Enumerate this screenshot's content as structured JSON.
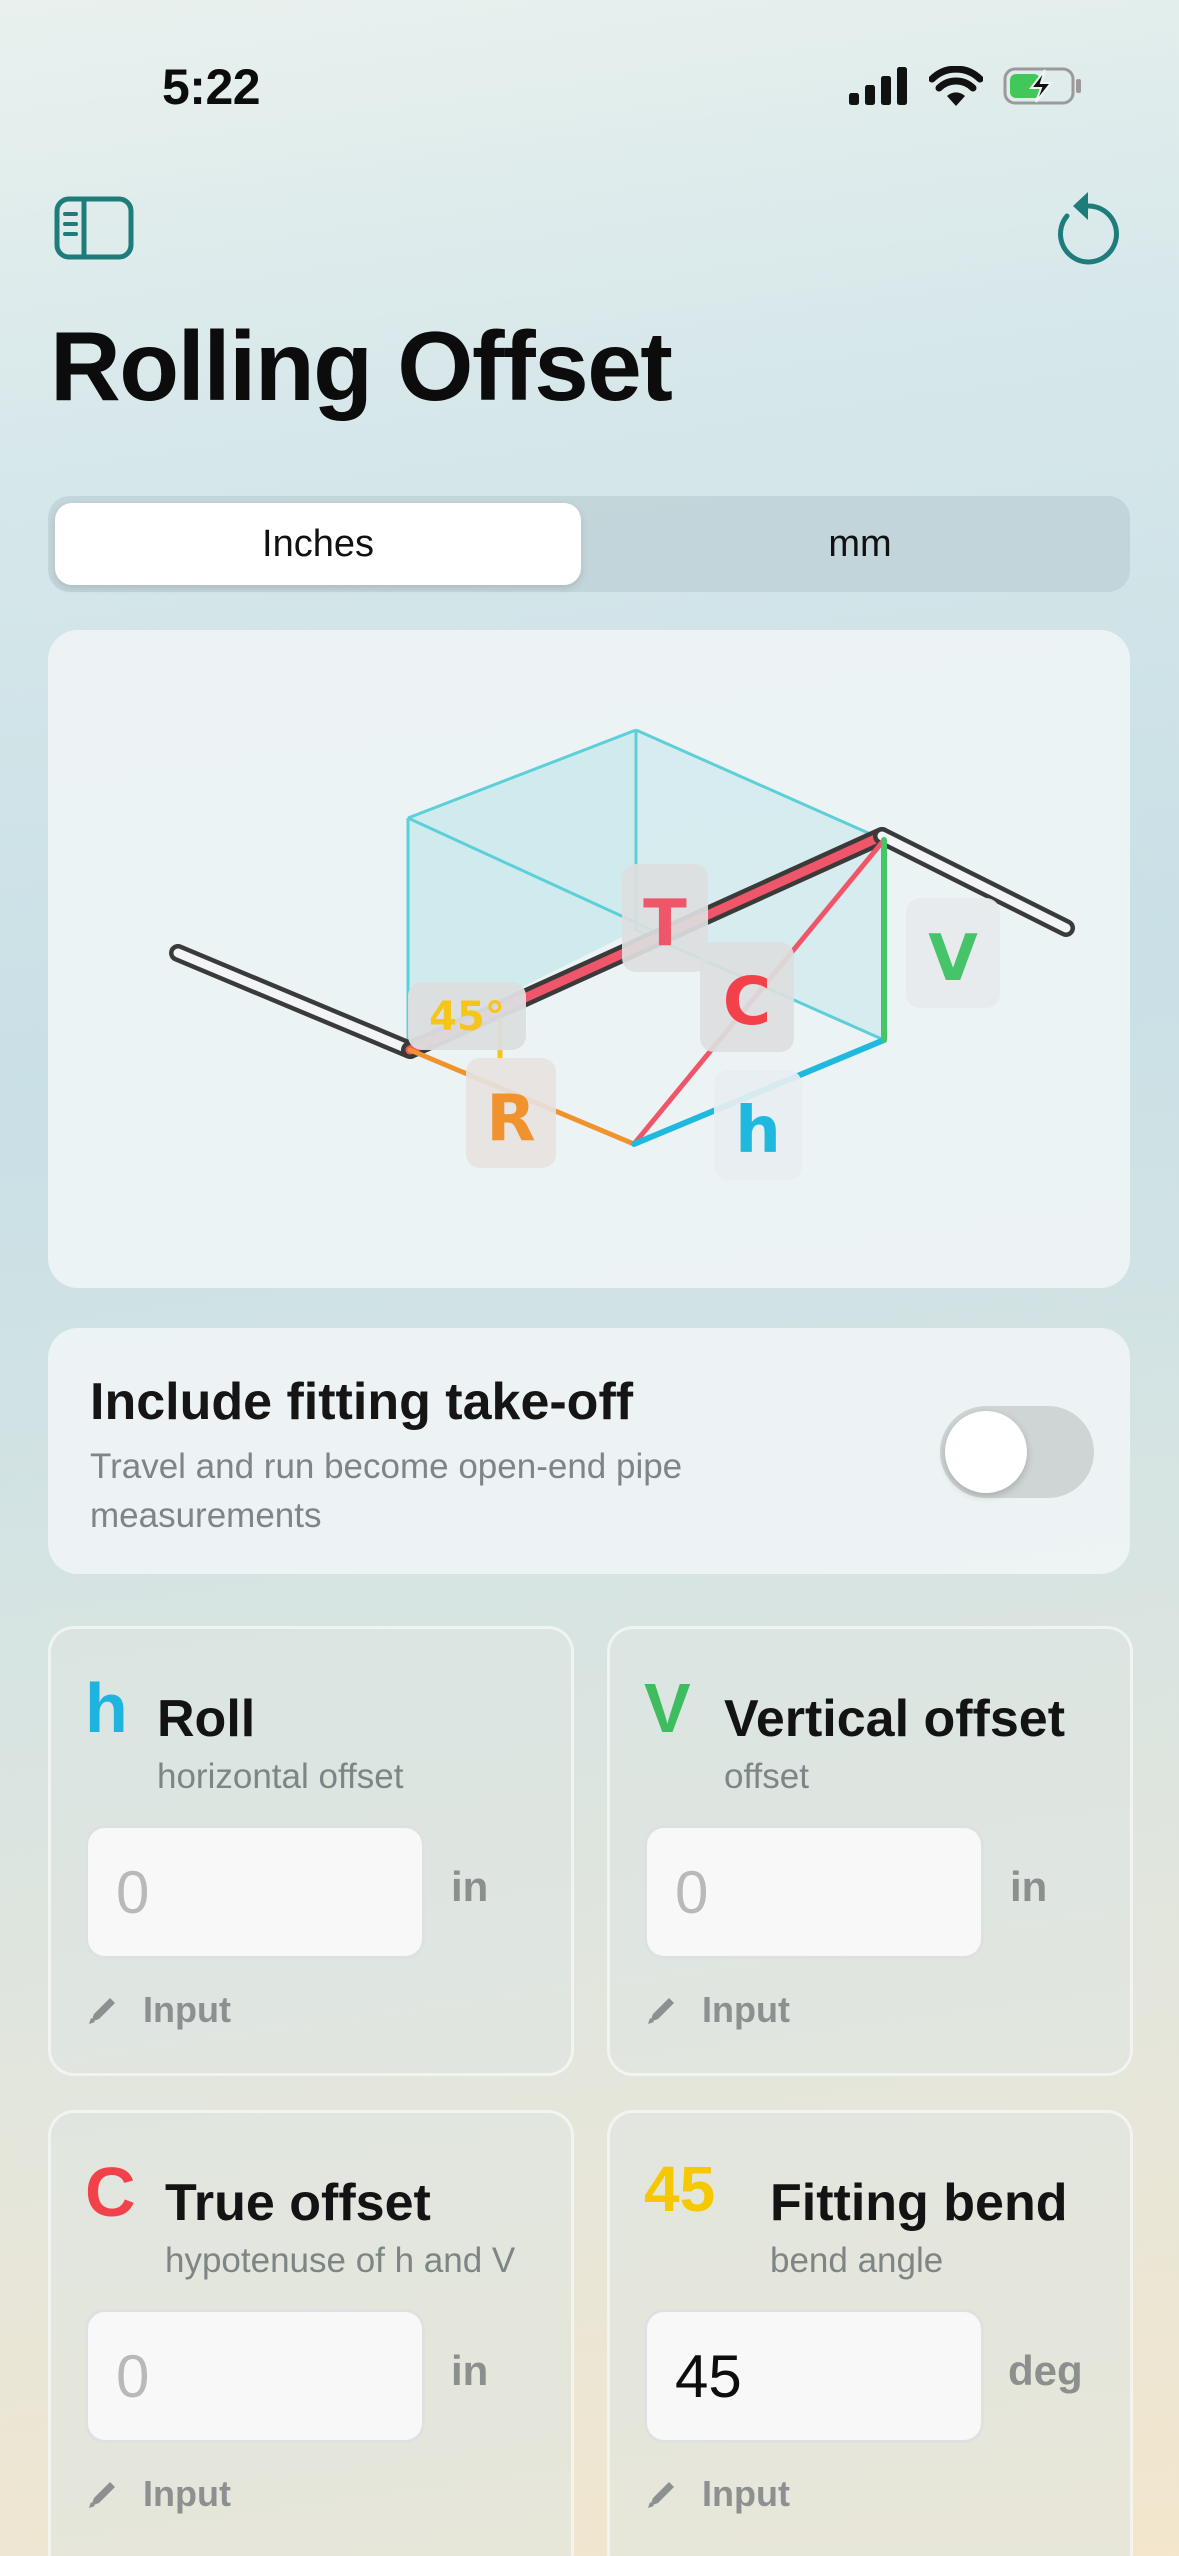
{
  "status_bar": {
    "time": "5:22"
  },
  "header": {
    "title": "Rolling Offset"
  },
  "units": {
    "options": [
      "Inches",
      "mm"
    ],
    "selected": "Inches"
  },
  "diagram": {
    "labels": {
      "travel": "T",
      "true_offset": "C",
      "vertical": "V",
      "run": "R",
      "roll": "h",
      "angle": "45°"
    },
    "colors": {
      "pipe": "#3a3a3a",
      "travel": "#f0566a",
      "vertical": "#45c46a",
      "roll": "#1fb9e0",
      "run": "#f0922e",
      "angle": "#f5c518",
      "box": "#5ccfd9"
    }
  },
  "takeoff": {
    "title": "Include fitting take-off",
    "subtitle": "Travel and run become open-end pipe measurements",
    "enabled": false
  },
  "inputs": [
    {
      "glyph": "h",
      "glyph_color": "#1fb3e0",
      "title": "Roll",
      "subtitle": "horizontal offset",
      "value": "",
      "placeholder": "0",
      "unit": "in",
      "mode": "Input"
    },
    {
      "glyph": "V",
      "glyph_color": "#3fbd5e",
      "title": "Vertical offset",
      "subtitle": "offset",
      "value": "",
      "placeholder": "0",
      "unit": "in",
      "mode": "Input"
    },
    {
      "glyph": "C",
      "glyph_color": "#f2414a",
      "title": "True offset",
      "subtitle": "hypotenuse of h and V",
      "value": "",
      "placeholder": "0",
      "unit": "in",
      "mode": "Input"
    },
    {
      "glyph": "45",
      "glyph_color": "#f5c800",
      "title": "Fitting bend",
      "subtitle": "bend angle",
      "value": "45",
      "placeholder": "0",
      "unit": "deg",
      "mode": "Input"
    }
  ]
}
